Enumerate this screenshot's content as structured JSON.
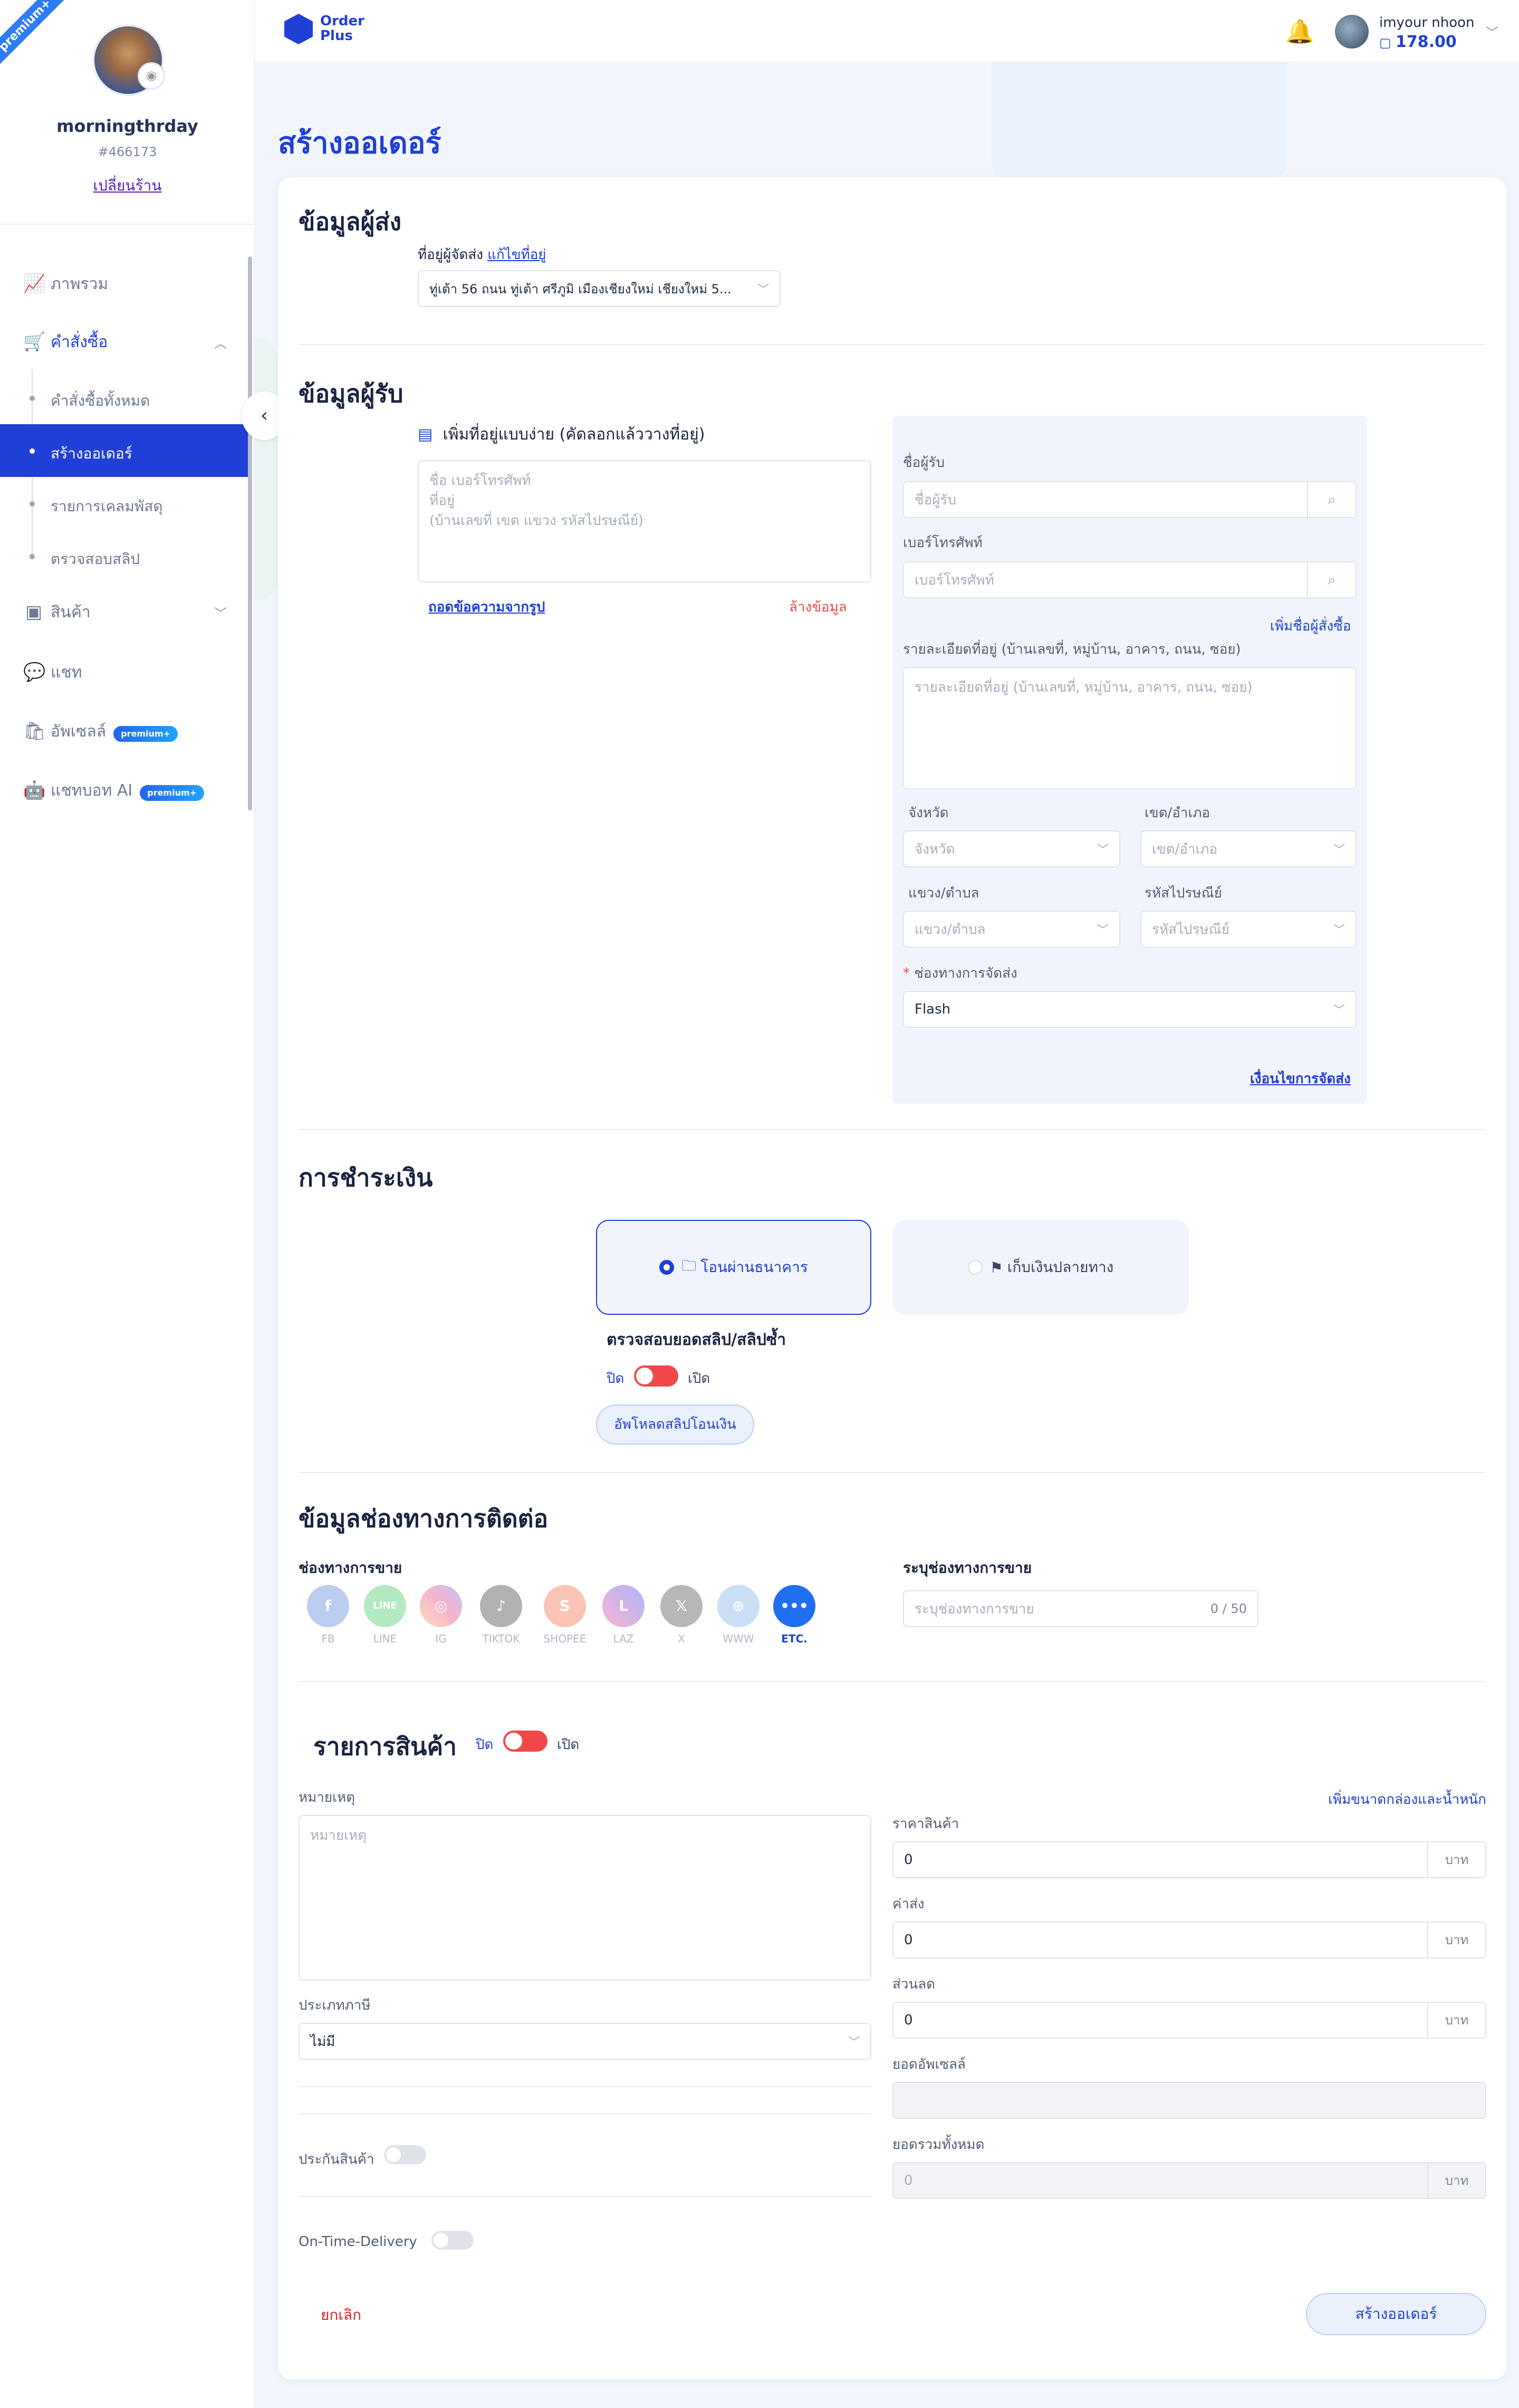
{
  "sidebar": {
    "premium_ribbon": "premium+",
    "username": "morningthrday",
    "user_id": "#466173",
    "switch_shop": "เปลี่ยนร้าน",
    "nav": {
      "overview": "ภาพรวม",
      "orders": "คำสั่งซื้อ",
      "orders_all": "คำสั่งซื้อทั้งหมด",
      "create_order": "สร้างออเดอร์",
      "parcel_claims": "รายการเคลมพัสดุ",
      "check_slip": "ตรวจสอบสลิป",
      "products": "สินค้า",
      "chat": "แชท",
      "upsell": "อัพเซลล์",
      "ai_chat": "แชทบอท AI",
      "premium_badge": "premium+"
    }
  },
  "header": {
    "logo_line1": "Order",
    "logo_line2": "Plus",
    "user_name": "imyour nhoon",
    "credit": "178.00"
  },
  "page": {
    "title": "สร้างออเดอร์"
  },
  "sender": {
    "title": "ข้อมูลผู้ส่ง",
    "address_label": "ที่อยู่ผู้จัดส่ง",
    "edit_address": "แก้ไขที่อยู่",
    "address_value": "ทู่เต้า 56 ถนน ทู่เต้า ศรีภูมิ เมืองเชียงใหม่ เชียงใหม่ 5..."
  },
  "receiver": {
    "title": "ข้อมูลผู้รับ",
    "quick_add": "เพิ่มที่อยู่แบบง่าย (คัดลอกแล้ววางที่อยู่)",
    "quick_placeholder": "ชื่อ เบอร์โทรศัพท์\nที่อยู่\n(บ้านเลขที่ เขต แขวง รหัสไปรษณีย์)",
    "extract_from_image": "ถอดข้อความจากรูป",
    "clear": "ล้างข้อมูล",
    "name_label": "ชื่อผู้รับ",
    "name_placeholder": "ชื่อผู้รับ",
    "phone_label": "เบอร์โทรศัพท์",
    "phone_placeholder": "เบอร์โทรศัพท์",
    "add_buyer": "เพิ่มชื่อผู้สั่งซื้อ",
    "address_label": "รายละเอียดที่อยู่ (บ้านเลขที่, หมู่บ้าน, อาคาร, ถนน, ซอย)",
    "address_placeholder": "รายละเอียดที่อยู่ (บ้านเลขที่, หมู่บ้าน, อาคาร, ถนน, ซอย)",
    "province_label": "จังหวัด",
    "province_placeholder": "จังหวัด",
    "district_label": "เขต/อำเภอ",
    "district_placeholder": "เขต/อำเภอ",
    "subdistrict_label": "แขวง/ตำบล",
    "subdistrict_placeholder": "แขวง/ตำบล",
    "postcode_label": "รหัสไปรษณีย์",
    "postcode_placeholder": "รหัสไปรษณีย์",
    "shipping_label": "ช่องทางการจัดส่ง",
    "shipping_value": "Flash",
    "shipping_terms": "เงื่อนไขการจัดส่ง"
  },
  "payment": {
    "title": "การชำระเงิน",
    "bank_transfer": "โอนผ่านธนาคาร",
    "cod": "เก็บเงินปลายทาง",
    "verify_label": "ตรวจสอบยอดสลิป/สลิปซ้ำ",
    "off": "ปิด",
    "on": "เปิด",
    "upload_slip": "อัพโหลดสลิปโอนเงิน"
  },
  "contact": {
    "title": "ข้อมูลช่องทางการติดต่อ",
    "channel_label": "ช่องทางการขาย",
    "channels": [
      "FB",
      "LINE",
      "IG",
      "TIKTOK",
      "SHOPEE",
      "LAZ",
      "X",
      "WWW",
      "ETC."
    ],
    "specify_label": "ระบุช่องทางการขาย",
    "specify_placeholder": "ระบุช่องทางการขาย",
    "counter": "0 / 50"
  },
  "products": {
    "title": "รายการสินค้า",
    "off": "ปิด",
    "on": "เปิด",
    "note_label": "หมายเหตุ",
    "note_placeholder": "หมายเหตุ",
    "tax_label": "ประเภทภาษี",
    "tax_value": "ไม่มี",
    "insurance": "ประกันสินค้า",
    "otd": "On-Time-Delivery",
    "add_box": "เพิ่มขนาดกล่องและน้ำหนัก",
    "price_label": "ราคาสินค้า",
    "price_value": "0",
    "shipping_label": "ค่าส่ง",
    "shipping_value": "0",
    "discount_label": "ส่วนลด",
    "discount_value": "0",
    "upsell_label": "ยอดอัพเซลล์",
    "total_label": "ยอดรวมทั้งหมด",
    "total_value": "0",
    "unit": "บาท"
  },
  "footer": {
    "cancel": "ยกเลิก",
    "create": "สร้างออเดอร์"
  },
  "colors": {
    "primary": "#1f3fd6",
    "danger": "#f04848",
    "panel": "#f2f4fc"
  }
}
